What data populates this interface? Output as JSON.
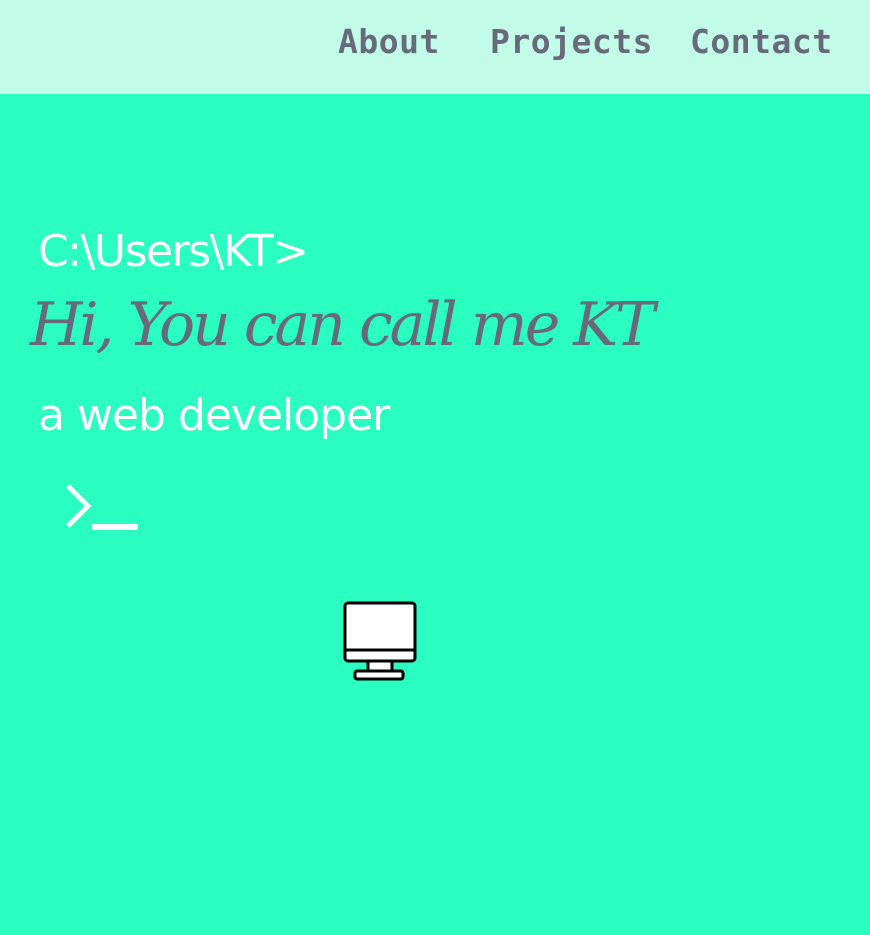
{
  "nav": {
    "items": [
      {
        "label": "About"
      },
      {
        "label": "Projects"
      },
      {
        "label": "Contact"
      }
    ]
  },
  "hero": {
    "prompt_path": "C:\\Users\\KT>",
    "greeting": "Hi, You can call me KT",
    "role": "a web developer",
    "terminal_icon": "terminal-prompt-icon",
    "monitor_icon": "desktop-monitor-icon"
  },
  "colors": {
    "background": "#2affc1",
    "navbar": "#c2fbe7",
    "nav_text": "#676a7b",
    "greeting_text": "#676a7b",
    "light_text": "#ffffff"
  }
}
